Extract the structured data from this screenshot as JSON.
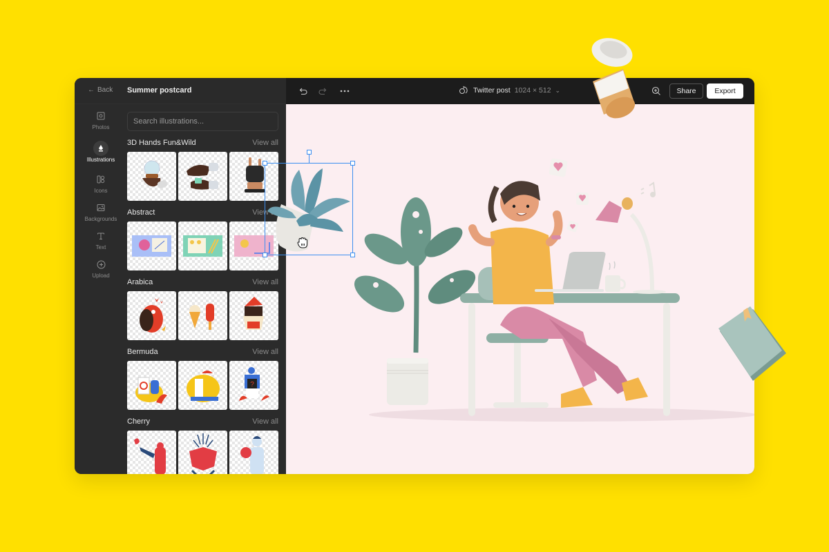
{
  "header": {
    "back_label": "Back",
    "document_title": "Summer postcard"
  },
  "rail": {
    "items": [
      {
        "label": "Photos",
        "icon": "photo-icon",
        "active": false
      },
      {
        "label": "Illustrations",
        "icon": "pen-nib-icon",
        "active": true
      },
      {
        "label": "Icons",
        "icon": "shapes-icon",
        "active": false
      },
      {
        "label": "Backgrounds",
        "icon": "image-icon",
        "active": false
      },
      {
        "label": "Text",
        "icon": "text-icon",
        "active": false
      },
      {
        "label": "Upload",
        "icon": "plus-circle-icon",
        "active": false
      }
    ]
  },
  "panel": {
    "search_placeholder": "Search illustrations...",
    "sections": [
      {
        "title": "3D Hands Fun&Wild",
        "view_all": "View all",
        "thumbs": [
          "hand-snow-globe",
          "hands-with-gift",
          "hand-rock-glove"
        ]
      },
      {
        "title": "Abstract",
        "view_all": "View all",
        "thumbs": [
          "abstract-power-button",
          "abstract-people-board",
          "abstract-pink-stairs"
        ]
      },
      {
        "title": "Arabica",
        "view_all": "View all",
        "thumbs": [
          "arabica-monster-hearts",
          "arabica-icecream-popsicle",
          "arabica-santa"
        ]
      },
      {
        "title": "Bermuda",
        "view_all": "View all",
        "thumbs": [
          "bermuda-stop-sign",
          "bermuda-chef-cloche",
          "bermuda-question-box"
        ]
      },
      {
        "title": "Cherry",
        "view_all": "View all",
        "thumbs": [
          "cherry-megaphone",
          "cherry-open-box",
          "cherry-man-fan"
        ]
      }
    ]
  },
  "toolbar": {
    "undo": "undo-icon",
    "redo": "redo-icon",
    "more": "more-icon",
    "format_name": "Twitter post",
    "format_dims": "1024 × 512",
    "share_label": "Share",
    "export_label": "Export"
  },
  "canvas": {
    "background": "#FCEEF1",
    "selected_object": "potted-succulent",
    "scene": "woman-at-desk-with-laptop"
  },
  "colors": {
    "page_bg": "#FFE000",
    "panel_bg": "#2b2b2b",
    "toolbar_bg": "#1c1c1c",
    "selection": "#3b8ef0"
  }
}
